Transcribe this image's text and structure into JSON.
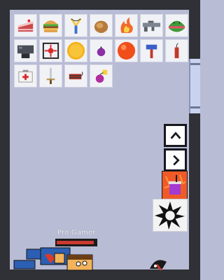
{
  "player": {
    "name": "Pro Gamer",
    "health": 0.95
  },
  "items": [
    {
      "icon": "cake-icon"
    },
    {
      "icon": "burger-icon"
    },
    {
      "icon": "slingshot-icon"
    },
    {
      "icon": "chicken-icon"
    },
    {
      "icon": "fire-icon"
    },
    {
      "icon": "rifle-icon"
    },
    {
      "icon": "melon-icon"
    },
    {
      "icon": "machine-icon"
    },
    {
      "icon": "target-icon"
    },
    {
      "icon": "gold-coin-icon"
    },
    {
      "icon": "purple-bomb-icon"
    },
    {
      "icon": "orange-ball-icon"
    },
    {
      "icon": "hammer-icon"
    },
    {
      "icon": "dynamite-stick-icon"
    },
    {
      "icon": "medkit-icon"
    },
    {
      "icon": "sword-icon"
    },
    {
      "icon": "dynamite-bundle-icon"
    },
    {
      "icon": "berry-icon"
    }
  ],
  "controls": {
    "up": "chevron-up-icon",
    "next": "chevron-right-icon",
    "power": "power-drink-icon",
    "spawn": "explosion-icon"
  },
  "colors": {
    "background": "#b9bcd5",
    "wall": "#2f3136",
    "health": "#c93a2f"
  }
}
